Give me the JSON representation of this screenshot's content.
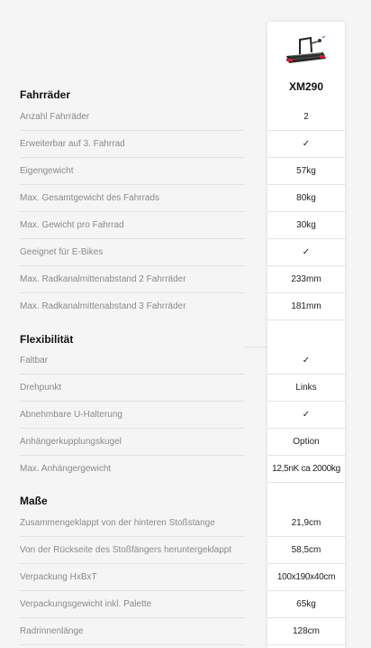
{
  "product": {
    "name": "XM290",
    "image_icon": "bike-carrier-image"
  },
  "sections": [
    {
      "title": "Fahrräder",
      "rows": [
        {
          "label": "Anzahl Fahrräder",
          "value": "2"
        },
        {
          "label": "Erweiterbar auf 3. Fahrrad",
          "value": "✓"
        },
        {
          "label": "Eigengewicht",
          "value": "57kg"
        },
        {
          "label": "Max. Gesamtgewicht des Fahrrads",
          "value": "80kg"
        },
        {
          "label": "Max. Gewicht pro Fahrrad",
          "value": "30kg"
        },
        {
          "label": "Geeignet für E-Bikes",
          "value": "✓"
        },
        {
          "label": "Max. Radkanalmittenabstand 2 Fahrräder",
          "value": "233mm"
        },
        {
          "label": "Max. Radkanalmittenabstand 3 Fahrräder",
          "value": "181mm"
        }
      ]
    },
    {
      "title": "Flexibilität",
      "rows": [
        {
          "label": "Faltbar",
          "value": "✓"
        },
        {
          "label": "Drehpunkt",
          "value": "Links"
        },
        {
          "label": "Abnehmbare U-Halterung",
          "value": "✓"
        },
        {
          "label": "Anhängerkupplungskugel",
          "value": "Option"
        },
        {
          "label": "Max. Anhängergewicht",
          "value": "12,5nK ca 2000kg"
        }
      ]
    },
    {
      "title": "Maße",
      "rows": [
        {
          "label": "Zusammengeklappt von der hinteren Stoßstange",
          "value": "21,9cm"
        },
        {
          "label": "Von der Rückseite des Stoßfängers heruntergeklappt",
          "value": "58,5cm"
        },
        {
          "label": "Verpackung HxBxT",
          "value": "100x190x40cm"
        },
        {
          "label": "Verpackungsgewicht inkl. Palette",
          "value": "65kg"
        },
        {
          "label": "Radrinnenlänge",
          "value": "128cm"
        }
      ]
    }
  ],
  "colors": {
    "page_bg": "#f5f5f5",
    "column_bg": "#ffffff",
    "label_text": "#8a8a8a",
    "value_text": "#222222",
    "accent_red": "#d22030"
  }
}
